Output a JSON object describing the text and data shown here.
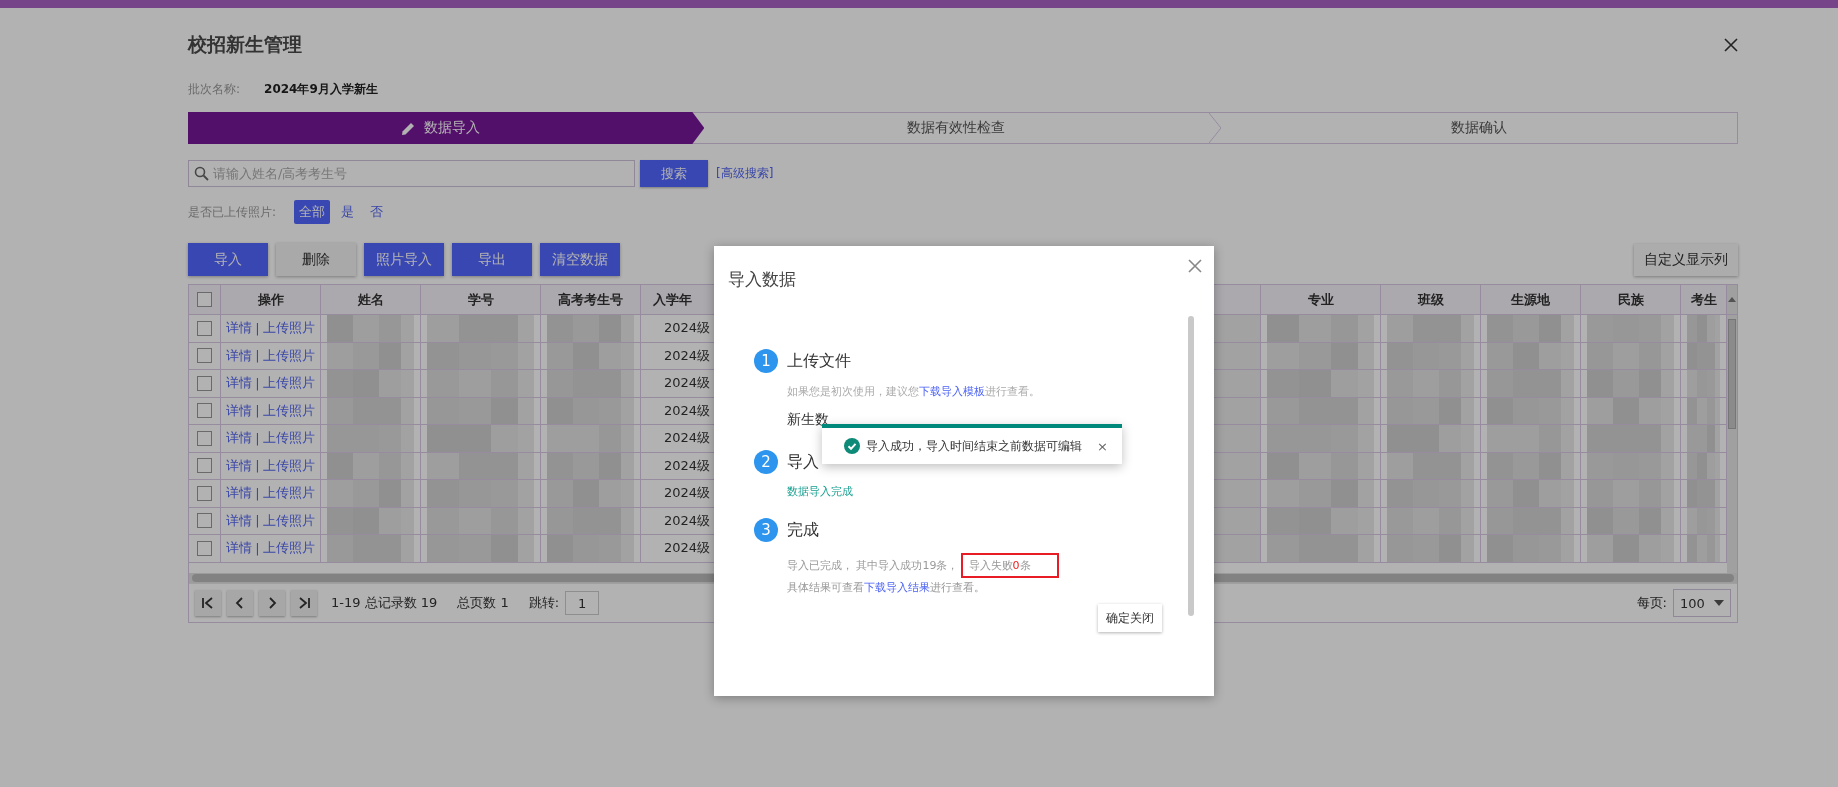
{
  "page": {
    "title": "校招新生管理"
  },
  "batch": {
    "label": "批次名称:",
    "value": "2024年9月入学新生"
  },
  "steps": [
    {
      "label": "数据导入",
      "selected": true
    },
    {
      "label": "数据有效性检查",
      "selected": false
    },
    {
      "label": "数据确认",
      "selected": false
    }
  ],
  "search": {
    "placeholder": "请输入姓名/高考考生号",
    "button": "搜索",
    "advanced_link": "[高级搜索]"
  },
  "photo_filter": {
    "label": "是否已上传照片:",
    "options": [
      {
        "label": "全部",
        "selected": true
      },
      {
        "label": "是",
        "selected": false
      },
      {
        "label": "否",
        "selected": false
      }
    ]
  },
  "toolbar": {
    "buttons": [
      {
        "label": "导入",
        "kind": "primary"
      },
      {
        "label": "删除",
        "kind": "plain"
      },
      {
        "label": "照片导入",
        "kind": "primary"
      },
      {
        "label": "导出",
        "kind": "primary"
      },
      {
        "label": "清空数据",
        "kind": "primary"
      }
    ],
    "custom_columns": "自定义显示列"
  },
  "table": {
    "select_all": {
      "checked": false
    },
    "separator": "|",
    "columns": [
      {
        "label": "操作",
        "kind": "actions"
      },
      {
        "label": "姓名",
        "kind": "blurred"
      },
      {
        "label": "学号",
        "kind": "blurred"
      },
      {
        "label": "高考考生号",
        "kind": "blurred"
      },
      {
        "label": "入学年",
        "kind": "year"
      },
      {
        "kind": "covered"
      },
      {
        "label": "专业",
        "kind": "blurred"
      },
      {
        "label": "班级",
        "kind": "blurred"
      },
      {
        "label": "生源地",
        "kind": "blurred"
      },
      {
        "label": "民族",
        "kind": "blurred"
      },
      {
        "label": "考生",
        "kind": "blurred"
      }
    ],
    "rows": [
      {
        "checked": false,
        "actions": [
          "详情",
          "上传照片"
        ],
        "year": "2024级"
      },
      {
        "checked": false,
        "actions": [
          "详情",
          "上传照片"
        ],
        "year": "2024级"
      },
      {
        "checked": false,
        "actions": [
          "详情",
          "上传照片"
        ],
        "year": "2024级"
      },
      {
        "checked": false,
        "actions": [
          "详情",
          "上传照片"
        ],
        "year": "2024级"
      },
      {
        "checked": false,
        "actions": [
          "详情",
          "上传照片"
        ],
        "year": "2024级"
      },
      {
        "checked": false,
        "actions": [
          "详情",
          "上传照片"
        ],
        "year": "2024级"
      },
      {
        "checked": false,
        "actions": [
          "详情",
          "上传照片"
        ],
        "year": "2024级"
      },
      {
        "checked": false,
        "actions": [
          "详情",
          "上传照片"
        ],
        "year": "2024级"
      },
      {
        "checked": false,
        "actions": [
          "详情",
          "上传照片"
        ],
        "year": "2024级"
      }
    ]
  },
  "pagination": {
    "range": "1-19 总记录数 19",
    "pages": "总页数 1",
    "jump_label": "跳转:",
    "jump_value": "1",
    "page_size_label": "每页:",
    "page_size": "100"
  },
  "dialog": {
    "title": "导入数据",
    "steps": [
      {
        "number": "1",
        "title": "上传文件",
        "kind": "upload",
        "hint_before": "如果您是初次使用，建议您",
        "hint_link": "下载导入模板",
        "hint_after": "进行查看。",
        "file_name": "新生数"
      },
      {
        "number": "2",
        "title": "导入",
        "kind": "status",
        "status": "数据导入完成"
      },
      {
        "number": "3",
        "title": "完成",
        "kind": "result",
        "summary": "导入已完成， 其中导入成功19条，",
        "failed_before": "导入失败",
        "failed_count": "0",
        "failed_after": "条",
        "detail_before": "具体结果可查看",
        "detail_link": "下载导入结果",
        "detail_after": "进行查看。"
      }
    ],
    "confirm_button": "确定关闭"
  },
  "toast": {
    "message": "导入成功，导入时间结束之前数据可编辑",
    "close": "×"
  }
}
